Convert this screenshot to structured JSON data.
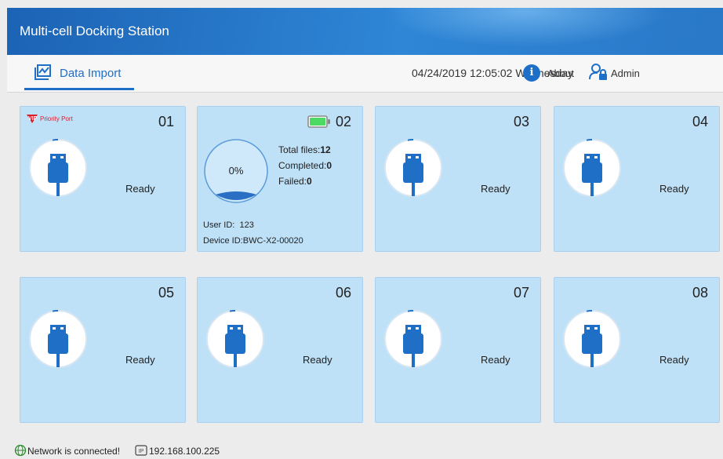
{
  "app": {
    "title": "Multi-cell Docking Station"
  },
  "nav": {
    "tab_label": "Data Import",
    "datetime": "04/24/2019 12:05:02 Wednesday",
    "about_label": "About",
    "admin_label": "Admin",
    "about_icon": "info-icon",
    "admin_icon": "user-lock-icon"
  },
  "ports": [
    {
      "number": "01",
      "status": "Ready",
      "badge": "Priority Port"
    },
    {
      "number": "02",
      "progress_text": "0%",
      "progress_value": 0,
      "total_files_label": "Total files:",
      "total_files": "12",
      "completed_label": "Completed:",
      "completed": "0",
      "failed_label": "Failed:",
      "failed": "0",
      "user_id_label": "User ID:",
      "user_id": "123",
      "device_id_label": "Device ID:",
      "device_id": "BWC-X2-00020",
      "battery_color": "#4cd964"
    },
    {
      "number": "03",
      "status": "Ready"
    },
    {
      "number": "04",
      "status": "Ready"
    },
    {
      "number": "05",
      "status": "Ready"
    },
    {
      "number": "06",
      "status": "Ready"
    },
    {
      "number": "07",
      "status": "Ready"
    },
    {
      "number": "08",
      "status": "Ready"
    }
  ],
  "statusbar": {
    "network": "Network is connected!",
    "ip": "192.168.100.225"
  },
  "colors": {
    "accent": "#1e6fc8",
    "card_bg": "#bfe1f8",
    "usb": "#1f6fc6",
    "vip": "#d81e2c"
  }
}
